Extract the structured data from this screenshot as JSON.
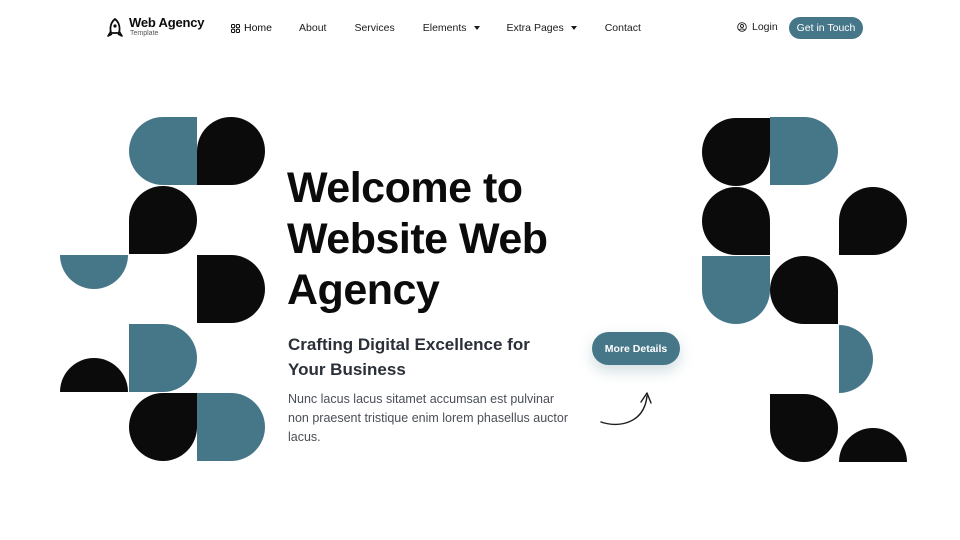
{
  "brand": {
    "name": "Web Agency",
    "tagline": "Template",
    "icon": "rocket-icon"
  },
  "nav": {
    "items": [
      {
        "label": "Home",
        "active": true,
        "icon": "grid-icon"
      },
      {
        "label": "About"
      },
      {
        "label": "Services"
      },
      {
        "label": "Elements",
        "dropdown": true
      },
      {
        "label": "Extra Pages",
        "dropdown": true
      },
      {
        "label": "Contact"
      }
    ],
    "login_label": "Login",
    "cta_label": "Get in Touch"
  },
  "hero": {
    "title": "Welcome to Website Web Agency",
    "subtitle": "Crafting Digital Excellence for Your Business",
    "description": "Nunc lacus lacus sitamet accumsan est pulvinar non praesent tristique enim lorem phasellus auctor lacus.",
    "button_label": "More Details"
  },
  "colors": {
    "accent": "#467789",
    "dark": "#0b0b0b",
    "background": "#ffffff"
  }
}
